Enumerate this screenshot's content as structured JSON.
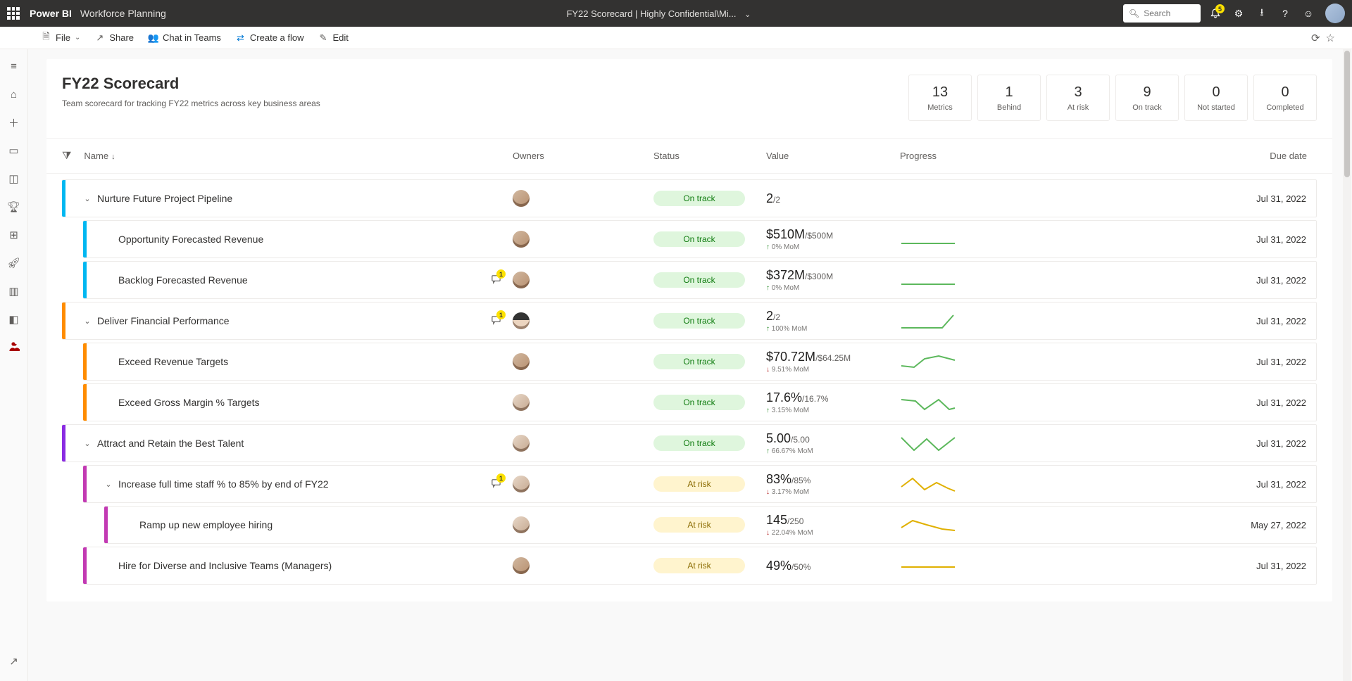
{
  "app": {
    "brand": "Power BI",
    "workspace": "Workforce Planning",
    "center": "FY22 Scorecard  |  Highly Confidential\\Mi...",
    "search_placeholder": "Search",
    "notification_count": "5"
  },
  "toolbar": {
    "file": "File",
    "share": "Share",
    "chat": "Chat in Teams",
    "flow": "Create a flow",
    "edit": "Edit"
  },
  "header": {
    "title": "FY22 Scorecard",
    "subtitle": "Team scorecard for tracking FY22 metrics across key business areas"
  },
  "summary": [
    {
      "num": "13",
      "lbl": "Metrics"
    },
    {
      "num": "1",
      "lbl": "Behind"
    },
    {
      "num": "3",
      "lbl": "At risk"
    },
    {
      "num": "9",
      "lbl": "On track"
    },
    {
      "num": "0",
      "lbl": "Not started"
    },
    {
      "num": "0",
      "lbl": "Completed"
    }
  ],
  "cols": {
    "name": "Name",
    "owners": "Owners",
    "status": "Status",
    "value": "Value",
    "progress": "Progress",
    "due": "Due date"
  },
  "status_labels": {
    "ontrack": "On track",
    "atrisk": "At risk"
  },
  "rows": [
    {
      "indent": 0,
      "color": "#00b7f1",
      "expand": true,
      "name": "Nurture Future Project Pipeline",
      "comment": "",
      "avatar": "f1",
      "status": "ontrack",
      "value": "2",
      "target": "/2",
      "trend": "",
      "trendDir": "",
      "spark": "",
      "due": "Jul 31, 2022"
    },
    {
      "indent": 1,
      "color": "#00b7f1",
      "expand": false,
      "name": "Opportunity Forecasted Revenue",
      "comment": "",
      "avatar": "f1",
      "status": "ontrack",
      "value": "$510M",
      "target": "/$500M",
      "trend": "0% MoM",
      "trendDir": "up",
      "spark": "flat-green",
      "due": "Jul 31, 2022"
    },
    {
      "indent": 1,
      "color": "#00b7f1",
      "expand": false,
      "name": "Backlog Forecasted Revenue",
      "comment": "1",
      "avatar": "f1",
      "status": "ontrack",
      "value": "$372M",
      "target": "/$300M",
      "trend": "0% MoM",
      "trendDir": "up",
      "spark": "flat-green",
      "due": "Jul 31, 2022"
    },
    {
      "indent": 0,
      "color": "#ff8c00",
      "expand": true,
      "name": "Deliver Financial Performance",
      "comment": "1",
      "avatar": "f3",
      "status": "ontrack",
      "value": "2",
      "target": "/2",
      "trend": "100% MoM",
      "trendDir": "up",
      "spark": "up-green",
      "due": "Jul 31, 2022"
    },
    {
      "indent": 1,
      "color": "#ff8c00",
      "expand": false,
      "name": "Exceed Revenue Targets",
      "comment": "",
      "avatar": "f1",
      "status": "ontrack",
      "value": "$70.72M",
      "target": "/$64.25M",
      "trend": "9.51% MoM",
      "trendDir": "down",
      "spark": "wave-green",
      "due": "Jul 31, 2022"
    },
    {
      "indent": 1,
      "color": "#ff8c00",
      "expand": false,
      "name": "Exceed Gross Margin % Targets",
      "comment": "",
      "avatar": "f2",
      "status": "ontrack",
      "value": "17.6%",
      "target": "/16.7%",
      "trend": "3.15% MoM",
      "trendDir": "up",
      "spark": "zig-green",
      "due": "Jul 31, 2022"
    },
    {
      "indent": 0,
      "color": "#8a2be2",
      "expand": true,
      "name": "Attract and Retain the Best Talent",
      "comment": "",
      "avatar": "f2",
      "status": "ontrack",
      "value": "5.00",
      "target": "/5.00",
      "trend": "66.67% MoM",
      "trendDir": "up",
      "spark": "v-green",
      "due": "Jul 31, 2022"
    },
    {
      "indent": 1,
      "color": "#c239b3",
      "expand": true,
      "name": "Increase full time staff % to 85% by end of FY22",
      "comment": "1",
      "avatar": "f2",
      "status": "atrisk",
      "value": "83%",
      "target": "/85%",
      "trend": "3.17% MoM",
      "trendDir": "down",
      "spark": "wave-amber",
      "due": "Jul 31, 2022"
    },
    {
      "indent": 2,
      "color": "#c239b3",
      "expand": false,
      "name": "Ramp up new employee hiring",
      "comment": "",
      "avatar": "f2",
      "status": "atrisk",
      "value": "145",
      "target": "/250",
      "trend": "22.04% MoM",
      "trendDir": "down",
      "spark": "down-amber",
      "due": "May 27, 2022"
    },
    {
      "indent": 1,
      "color": "#c239b3",
      "expand": false,
      "name": "Hire for Diverse and Inclusive Teams (Managers)",
      "comment": "",
      "avatar": "f1",
      "status": "atrisk",
      "value": "49%",
      "target": "/50%",
      "trend": "",
      "trendDir": "",
      "spark": "flat-amber",
      "due": "Jul 31, 2022"
    }
  ]
}
